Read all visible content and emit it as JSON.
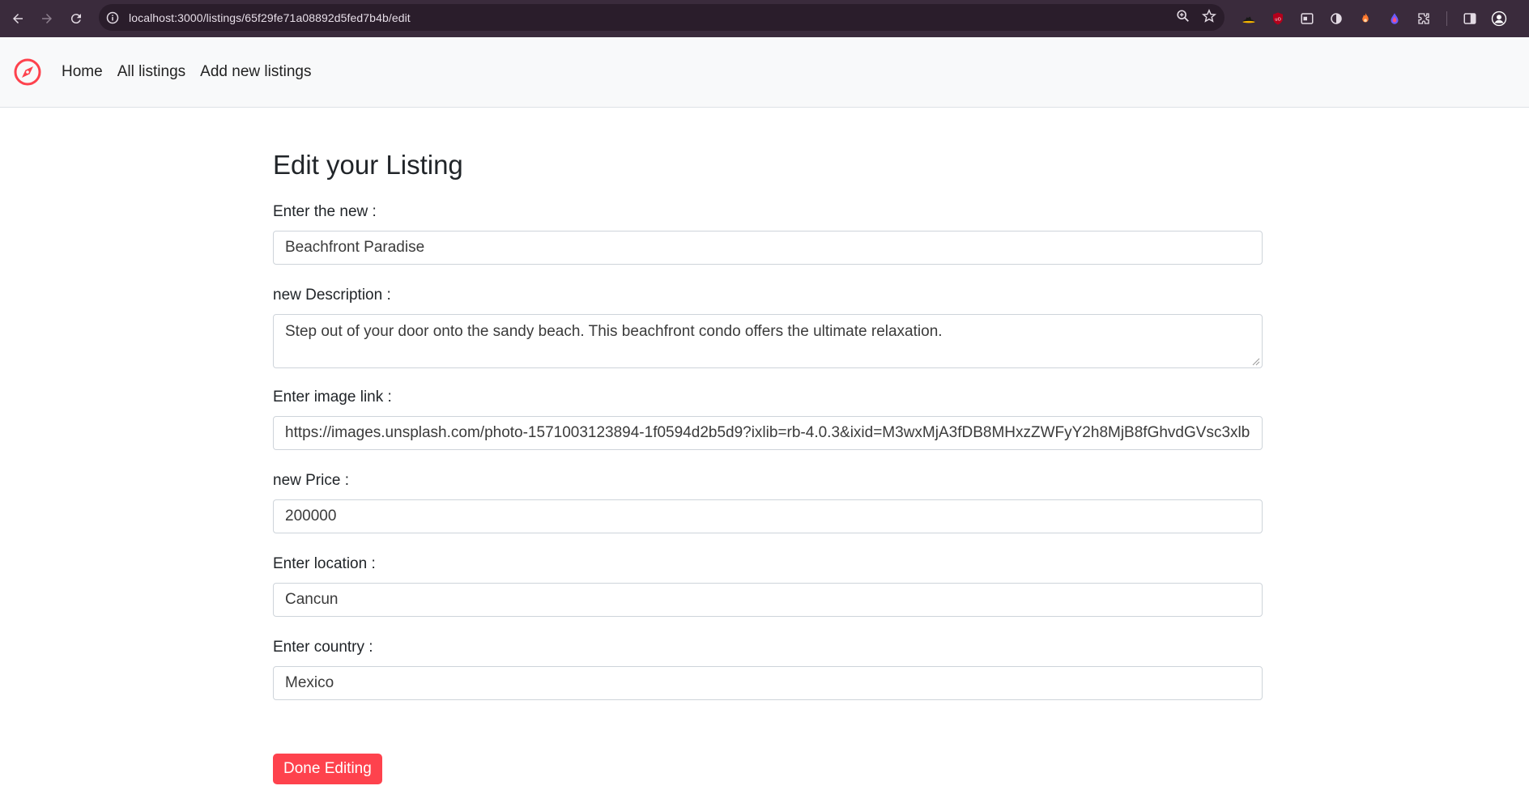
{
  "browser": {
    "url": "localhost:3000/listings/65f29fe71a08892d5fed7b4b/edit",
    "extension_icons": [
      "zoom-icon",
      "star-icon",
      "hat-extension-icon",
      "ublock-icon",
      "window-extension-icon",
      "dark-mode-icon",
      "fire-extension-icon",
      "drop-extension-icon",
      "puzzle-icon",
      "side-panel-icon",
      "profile-icon"
    ]
  },
  "site_nav": {
    "brand_icon": "compass-icon",
    "brand_color": "#fe424d",
    "links": [
      {
        "label": "Home"
      },
      {
        "label": "All listings"
      },
      {
        "label": "Add new listings"
      }
    ]
  },
  "form": {
    "title": "Edit your Listing",
    "fields": {
      "title": {
        "label": "Enter the new :",
        "value": "Beachfront Paradise"
      },
      "description": {
        "label": "new Description :",
        "value": "Step out of your door onto the sandy beach. This beachfront condo offers the ultimate relaxation."
      },
      "image": {
        "label": "Enter image link :",
        "value": "https://images.unsplash.com/photo-1571003123894-1f0594d2b5d9?ixlib=rb-4.0.3&ixid=M3wxMjA3fDB8MHxzZWFyY2h8MjB8fGhvdGVsc3xlb"
      },
      "price": {
        "label": "new Price :",
        "value": "200000"
      },
      "location": {
        "label": "Enter location :",
        "value": "Cancun"
      },
      "country": {
        "label": "Enter country :",
        "value": "Mexico"
      }
    },
    "submit_label": "Done Editing",
    "submit_color": "#fe424d"
  }
}
